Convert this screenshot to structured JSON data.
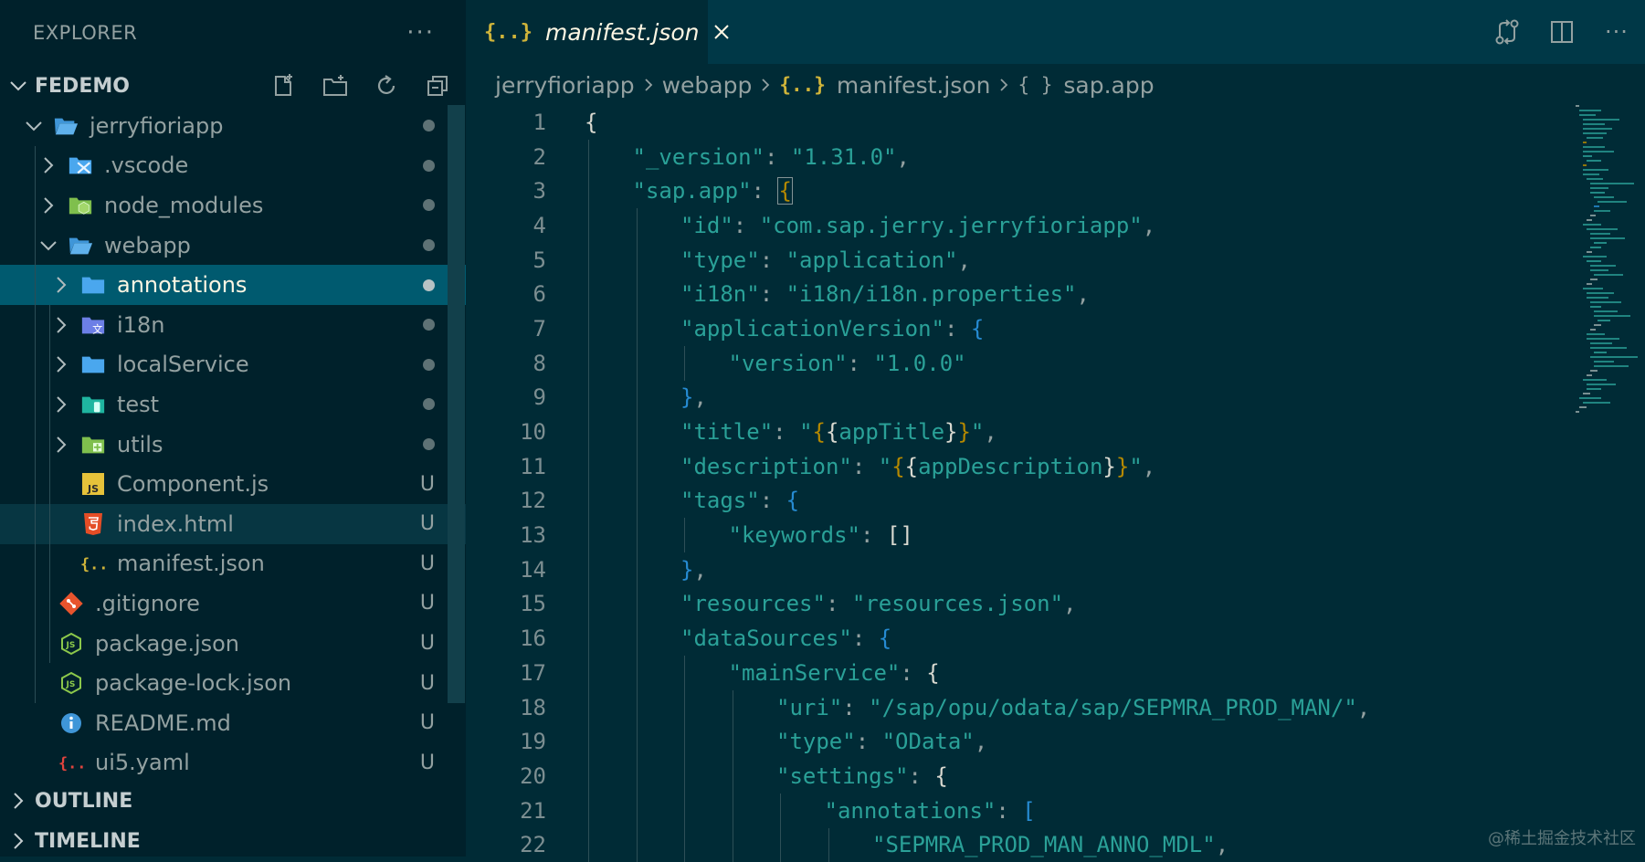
{
  "sidebar": {
    "title": "EXPLORER",
    "more": "···",
    "workspace": "FEDEMO",
    "tree": [
      {
        "label": "jerryfioriapp",
        "depth": 1,
        "chevron": "down",
        "icon": "folder-open-icon",
        "status": "dot"
      },
      {
        "label": ".vscode",
        "depth": 2,
        "chevron": "right",
        "icon": "vscode-folder-icon",
        "status": "dot"
      },
      {
        "label": "node_modules",
        "depth": 2,
        "chevron": "right",
        "icon": "node-folder-icon",
        "status": "dot"
      },
      {
        "label": "webapp",
        "depth": 2,
        "chevron": "down",
        "icon": "folder-open-icon",
        "status": "dot"
      },
      {
        "label": "annotations",
        "depth": 3,
        "chevron": "right",
        "icon": "folder-icon",
        "status": "dot",
        "selected": true
      },
      {
        "label": "i18n",
        "depth": 3,
        "chevron": "right",
        "icon": "i18n-folder-icon",
        "status": "dot"
      },
      {
        "label": "localService",
        "depth": 3,
        "chevron": "right",
        "icon": "folder-icon",
        "status": "dot"
      },
      {
        "label": "test",
        "depth": 3,
        "chevron": "right",
        "icon": "test-folder-icon",
        "status": "dot"
      },
      {
        "label": "utils",
        "depth": 3,
        "chevron": "right",
        "icon": "utils-folder-icon",
        "status": "dot"
      },
      {
        "label": "Component.js",
        "depth": 3,
        "chevron": "",
        "icon": "js-file-icon",
        "status": "U"
      },
      {
        "label": "index.html",
        "depth": 3,
        "chevron": "",
        "icon": "html-file-icon",
        "status": "U",
        "focused": true
      },
      {
        "label": "manifest.json",
        "depth": 3,
        "chevron": "",
        "icon": "json-file-icon",
        "status": "U"
      },
      {
        "label": ".gitignore",
        "depth": 2,
        "chevron": "",
        "icon": "git-file-icon",
        "status": "U"
      },
      {
        "label": "package.json",
        "depth": 2,
        "chevron": "",
        "icon": "nodejs-file-icon",
        "status": "U"
      },
      {
        "label": "package-lock.json",
        "depth": 2,
        "chevron": "",
        "icon": "nodejs-file-icon",
        "status": "U"
      },
      {
        "label": "README.md",
        "depth": 2,
        "chevron": "",
        "icon": "info-file-icon",
        "status": "U"
      },
      {
        "label": "ui5.yaml",
        "depth": 2,
        "chevron": "",
        "icon": "yaml-file-icon",
        "status": "U"
      }
    ],
    "outline": "OUTLINE",
    "timeline": "TIMELINE"
  },
  "editor": {
    "tab": {
      "icon": "{..}",
      "label": "manifest.json"
    },
    "breadcrumb": {
      "items": [
        "jerryfioriapp",
        "webapp",
        "manifest.json",
        "sap.app"
      ],
      "json_icon": "{..}",
      "obj_icon": "{ }"
    },
    "lines": [
      {
        "n": "1",
        "indent": 0,
        "tokens": [
          [
            "b1",
            "{"
          ]
        ]
      },
      {
        "n": "2",
        "indent": 1,
        "tokens": [
          [
            "k",
            "\"_version\""
          ],
          [
            "p",
            ": "
          ],
          [
            "s",
            "\"1.31.0\""
          ],
          [
            "p",
            ","
          ]
        ]
      },
      {
        "n": "3",
        "indent": 1,
        "tokens": [
          [
            "k",
            "\"sap.app\""
          ],
          [
            "p",
            ": "
          ],
          [
            "b2 mm",
            "{"
          ]
        ]
      },
      {
        "n": "4",
        "indent": 2,
        "tokens": [
          [
            "k",
            "\"id\""
          ],
          [
            "p",
            ": "
          ],
          [
            "s",
            "\"com.sap.jerry.jerryfioriapp\""
          ],
          [
            "p",
            ","
          ]
        ]
      },
      {
        "n": "5",
        "indent": 2,
        "tokens": [
          [
            "k",
            "\"type\""
          ],
          [
            "p",
            ": "
          ],
          [
            "s",
            "\"application\""
          ],
          [
            "p",
            ","
          ]
        ]
      },
      {
        "n": "6",
        "indent": 2,
        "tokens": [
          [
            "k",
            "\"i18n\""
          ],
          [
            "p",
            ": "
          ],
          [
            "s",
            "\"i18n/i18n.properties\""
          ],
          [
            "p",
            ","
          ]
        ]
      },
      {
        "n": "7",
        "indent": 2,
        "tokens": [
          [
            "k",
            "\"applicationVersion\""
          ],
          [
            "p",
            ": "
          ],
          [
            "b3",
            "{"
          ]
        ]
      },
      {
        "n": "8",
        "indent": 3,
        "tokens": [
          [
            "k",
            "\"version\""
          ],
          [
            "p",
            ": "
          ],
          [
            "s",
            "\"1.0.0\""
          ]
        ]
      },
      {
        "n": "9",
        "indent": 2,
        "tokens": [
          [
            "b3",
            "}"
          ],
          [
            "p",
            ","
          ]
        ]
      },
      {
        "n": "10",
        "indent": 2,
        "tokens": [
          [
            "k",
            "\"title\""
          ],
          [
            "p",
            ": "
          ],
          [
            "s",
            "\""
          ],
          [
            "b2",
            "{"
          ],
          [
            "b1",
            "{"
          ],
          [
            "s",
            "appTitle"
          ],
          [
            "b1",
            "}"
          ],
          [
            "b2",
            "}"
          ],
          [
            "s",
            "\""
          ],
          [
            "p",
            ","
          ]
        ]
      },
      {
        "n": "11",
        "indent": 2,
        "tokens": [
          [
            "k",
            "\"description\""
          ],
          [
            "p",
            ": "
          ],
          [
            "s",
            "\""
          ],
          [
            "b2",
            "{"
          ],
          [
            "b1",
            "{"
          ],
          [
            "s",
            "appDescription"
          ],
          [
            "b1",
            "}"
          ],
          [
            "b2",
            "}"
          ],
          [
            "s",
            "\""
          ],
          [
            "p",
            ","
          ]
        ]
      },
      {
        "n": "12",
        "indent": 2,
        "tokens": [
          [
            "k",
            "\"tags\""
          ],
          [
            "p",
            ": "
          ],
          [
            "b3",
            "{"
          ]
        ]
      },
      {
        "n": "13",
        "indent": 3,
        "tokens": [
          [
            "k",
            "\"keywords\""
          ],
          [
            "p",
            ": "
          ],
          [
            "b1",
            "[]"
          ]
        ]
      },
      {
        "n": "14",
        "indent": 2,
        "tokens": [
          [
            "b3",
            "}"
          ],
          [
            "p",
            ","
          ]
        ]
      },
      {
        "n": "15",
        "indent": 2,
        "tokens": [
          [
            "k",
            "\"resources\""
          ],
          [
            "p",
            ": "
          ],
          [
            "s",
            "\"resources.json\""
          ],
          [
            "p",
            ","
          ]
        ]
      },
      {
        "n": "16",
        "indent": 2,
        "tokens": [
          [
            "k",
            "\"dataSources\""
          ],
          [
            "p",
            ": "
          ],
          [
            "b3",
            "{"
          ]
        ]
      },
      {
        "n": "17",
        "indent": 3,
        "tokens": [
          [
            "k",
            "\"mainService\""
          ],
          [
            "p",
            ": "
          ],
          [
            "b1",
            "{"
          ]
        ]
      },
      {
        "n": "18",
        "indent": 4,
        "tokens": [
          [
            "k",
            "\"uri\""
          ],
          [
            "p",
            ": "
          ],
          [
            "s",
            "\"/sap/opu/odata/sap/SEPMRA_PROD_MAN/\""
          ],
          [
            "p",
            ","
          ]
        ]
      },
      {
        "n": "19",
        "indent": 4,
        "tokens": [
          [
            "k",
            "\"type\""
          ],
          [
            "p",
            ": "
          ],
          [
            "s",
            "\"OData\""
          ],
          [
            "p",
            ","
          ]
        ]
      },
      {
        "n": "20",
        "indent": 4,
        "tokens": [
          [
            "k",
            "\"settings\""
          ],
          [
            "p",
            ": "
          ],
          [
            "b1",
            "{"
          ]
        ]
      },
      {
        "n": "21",
        "indent": 5,
        "tokens": [
          [
            "k",
            "\"annotations\""
          ],
          [
            "p",
            ": "
          ],
          [
            "b3",
            "["
          ]
        ]
      },
      {
        "n": "22",
        "indent": 6,
        "tokens": [
          [
            "s",
            "\"SEPMRA_PROD_MAN_ANNO_MDL\""
          ],
          [
            "p",
            ","
          ]
        ]
      }
    ]
  },
  "watermark": "@稀土掘金技术社区",
  "colors": {
    "accent_selected": "#005a6f",
    "string": "#2aa198",
    "bracket_gold": "#b58900",
    "bracket_blue": "#268bd2"
  }
}
